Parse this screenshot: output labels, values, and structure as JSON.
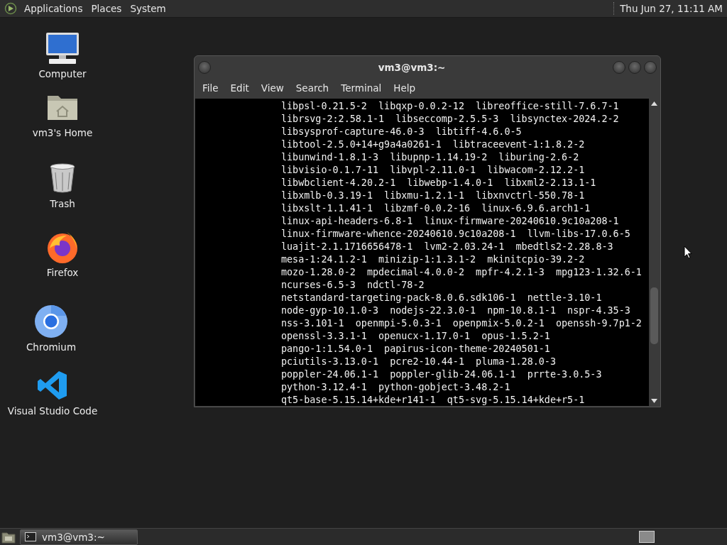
{
  "top_panel": {
    "menus": [
      "Applications",
      "Places",
      "System"
    ],
    "clock": "Thu Jun 27, 11:11 AM"
  },
  "desktop_icons": [
    {
      "label": "Computer",
      "kind": "computer"
    },
    {
      "label": "vm3's Home",
      "kind": "home"
    },
    {
      "label": "Trash",
      "kind": "trash"
    },
    {
      "label": "Firefox",
      "kind": "firefox"
    },
    {
      "label": "Chromium",
      "kind": "chromium"
    },
    {
      "label": "Visual Studio Code",
      "kind": "vscode"
    }
  ],
  "terminal": {
    "title": "vm3@vm3:~",
    "menu": [
      "File",
      "Edit",
      "View",
      "Search",
      "Terminal",
      "Help"
    ],
    "lines": [
      "libpsl-0.21.5-2  libqxp-0.0.2-12  libreoffice-still-7.6.7-1",
      "librsvg-2:2.58.1-1  libseccomp-2.5.5-3  libsynctex-2024.2-2",
      "libsysprof-capture-46.0-3  libtiff-4.6.0-5",
      "libtool-2.5.0+14+g9a4a0261-1  libtraceevent-1:1.8.2-2",
      "libunwind-1.8.1-3  libupnp-1.14.19-2  liburing-2.6-2",
      "libvisio-0.1.7-11  libvpl-2.11.0-1  libwacom-2.12.2-1",
      "libwbclient-4.20.2-1  libwebp-1.4.0-1  libxml2-2.13.1-1",
      "libxmlb-0.3.19-1  libxmu-1.2.1-1  libxnvctrl-550.78-1",
      "libxslt-1.1.41-1  libzmf-0.0.2-16  linux-6.9.6.arch1-1",
      "linux-api-headers-6.8-1  linux-firmware-20240610.9c10a208-1",
      "linux-firmware-whence-20240610.9c10a208-1  llvm-libs-17.0.6-5",
      "luajit-2.1.1716656478-1  lvm2-2.03.24-1  mbedtls2-2.28.8-3",
      "mesa-1:24.1.2-1  minizip-1:1.3.1-2  mkinitcpio-39.2-2",
      "mozo-1.28.0-2  mpdecimal-4.0.0-2  mpfr-4.2.1-3  mpg123-1.32.6-1",
      "ncurses-6.5-3  ndctl-78-2",
      "netstandard-targeting-pack-8.0.6.sdk106-1  nettle-3.10-1",
      "node-gyp-10.1.0-3  nodejs-22.3.0-1  npm-10.8.1-1  nspr-4.35-3",
      "nss-3.101-1  openmpi-5.0.3-1  openpmix-5.0.2-1  openssh-9.7p1-2",
      "openssl-3.3.1-1  openucx-1.17.0-1  opus-1.5.2-1",
      "pango-1:1.54.0-1  papirus-icon-theme-20240501-1",
      "pciutils-3.13.0-1  pcre2-10.44-1  pluma-1.28.0-3",
      "poppler-24.06.1-1  poppler-glib-24.06.1-1  prrte-3.0.5-3",
      "python-3.12.4-1  python-gobject-3.48.2-1",
      "qt5-base-5.15.14+kde+r141-1  qt5-svg-5.15.14+kde+r5-1"
    ]
  },
  "taskbar": {
    "windows": [
      {
        "title": "vm3@vm3:~",
        "selected": true
      }
    ]
  }
}
